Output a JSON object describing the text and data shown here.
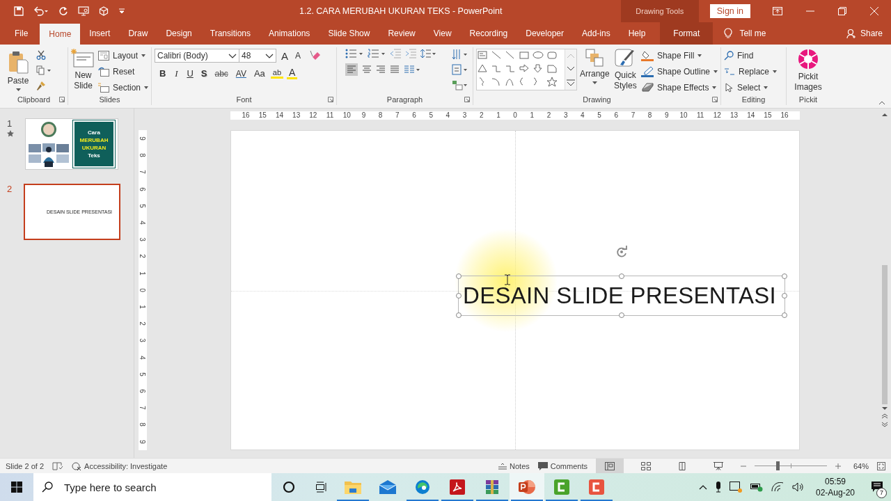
{
  "window": {
    "title": "1.2. CARA MERUBAH UKURAN TEKS  -  PowerPoint",
    "context_label": "Drawing Tools",
    "sign_in": "Sign in"
  },
  "tabs": [
    {
      "label": "File",
      "selected": false,
      "kind": "file"
    },
    {
      "label": "Home",
      "selected": true,
      "kind": "tab"
    },
    {
      "label": "Insert",
      "selected": false,
      "kind": "tab"
    },
    {
      "label": "Draw",
      "selected": false,
      "kind": "tab"
    },
    {
      "label": "Design",
      "selected": false,
      "kind": "tab"
    },
    {
      "label": "Transitions",
      "selected": false,
      "kind": "tab"
    },
    {
      "label": "Animations",
      "selected": false,
      "kind": "tab"
    },
    {
      "label": "Slide Show",
      "selected": false,
      "kind": "tab"
    },
    {
      "label": "Review",
      "selected": false,
      "kind": "tab"
    },
    {
      "label": "View",
      "selected": false,
      "kind": "tab"
    },
    {
      "label": "Recording",
      "selected": false,
      "kind": "tab"
    },
    {
      "label": "Developer",
      "selected": false,
      "kind": "tab"
    },
    {
      "label": "Add-ins",
      "selected": false,
      "kind": "tab"
    },
    {
      "label": "Help",
      "selected": false,
      "kind": "tab"
    },
    {
      "label": "Format",
      "selected": false,
      "kind": "contextual"
    }
  ],
  "tell_me": "Tell me",
  "share": "Share",
  "ribbon": {
    "clipboard": {
      "label": "Clipboard",
      "paste": "Paste"
    },
    "slides": {
      "label": "Slides",
      "new_slide": "New Slide",
      "commands": [
        {
          "label": "Layout",
          "kind": "layout"
        },
        {
          "label": "Reset",
          "kind": "reset"
        },
        {
          "label": "Section",
          "kind": "section"
        }
      ]
    },
    "font": {
      "label": "Font",
      "font_name": "Calibri (Body)",
      "font_size": "48",
      "size_buttons": [
        {
          "label": "A",
          "kind": "grow"
        },
        {
          "label": "A",
          "kind": "shrink"
        }
      ],
      "style_buttons": [
        {
          "label": "B",
          "kind": "bold"
        },
        {
          "label": "I",
          "kind": "italic"
        },
        {
          "label": "U",
          "kind": "underline"
        },
        {
          "label": "S",
          "kind": "shadow"
        },
        {
          "label": "abc",
          "kind": "strike"
        },
        {
          "label": "AV",
          "kind": "spacing"
        },
        {
          "label": "Aa",
          "kind": "case"
        }
      ],
      "highlight": "ab",
      "font_color": "A"
    },
    "paragraph": {
      "label": "Paragraph"
    },
    "drawing": {
      "label": "Drawing",
      "arrange": "Arrange",
      "quick_styles": "Quick Styles",
      "commands": [
        {
          "label": "Shape Fill",
          "kind": "fill"
        },
        {
          "label": "Shape Outline",
          "kind": "outline"
        },
        {
          "label": "Shape Effects",
          "kind": "effects"
        }
      ]
    },
    "editing": {
      "label": "Editing",
      "commands": [
        {
          "label": "Find",
          "kind": "find"
        },
        {
          "label": "Replace",
          "kind": "replace"
        },
        {
          "label": "Select",
          "kind": "select"
        }
      ]
    },
    "pickit": {
      "label": "Pickit",
      "button": "Pickit Images"
    }
  },
  "slides": [
    {
      "number": "1",
      "selected": false,
      "transition": true,
      "kind": "title",
      "lines": [
        {
          "text": "Cara",
          "highlight": false
        },
        {
          "text": "MERUBAH",
          "highlight": true
        },
        {
          "text": "UKURAN",
          "highlight": true
        },
        {
          "text": "Teks",
          "highlight": false
        }
      ]
    },
    {
      "number": "2",
      "selected": true,
      "transition": false,
      "kind": "text",
      "text": "DESAIN SLIDE PRESENTASI"
    }
  ],
  "rulers": {
    "horizontal": [
      "16",
      "15",
      "14",
      "13",
      "12",
      "11",
      "10",
      "9",
      "8",
      "7",
      "6",
      "5",
      "4",
      "3",
      "2",
      "1",
      "0",
      "1",
      "2",
      "3",
      "4",
      "5",
      "6",
      "7",
      "8",
      "9",
      "10",
      "11",
      "12",
      "13",
      "14",
      "15",
      "16"
    ],
    "vertical": [
      "9",
      "8",
      "7",
      "6",
      "5",
      "4",
      "3",
      "2",
      "1",
      "0",
      "1",
      "2",
      "3",
      "4",
      "5",
      "6",
      "7",
      "8",
      "9"
    ]
  },
  "slide": {
    "textbox": {
      "text": "DESAIN SLIDE PRESENTASI",
      "selected": true
    }
  },
  "status_bar": {
    "slide_info": "Slide 2 of 2",
    "accessibility": "Accessibility: Investigate",
    "notes": "Notes",
    "comments": "Comments",
    "views": [
      {
        "kind": "normal",
        "selected": true
      },
      {
        "kind": "sorter",
        "selected": false
      },
      {
        "kind": "reading",
        "selected": false
      },
      {
        "kind": "slideshow",
        "selected": false
      }
    ],
    "zoom": {
      "level": 0.32,
      "reading": "64%"
    }
  },
  "taskbar": {
    "search_placeholder": "Type here to search",
    "apps": [
      {
        "kind": "explorer",
        "running": true,
        "active": false
      },
      {
        "kind": "mail",
        "running": false,
        "active": false
      },
      {
        "kind": "edge",
        "running": true,
        "active": false
      },
      {
        "kind": "acrobat",
        "running": true,
        "active": false
      },
      {
        "kind": "archive",
        "running": true,
        "active": false
      },
      {
        "kind": "powerpoint",
        "running": true,
        "active": true
      },
      {
        "kind": "recorder",
        "running": true,
        "active": false
      },
      {
        "kind": "editor",
        "running": true,
        "active": false
      }
    ],
    "time": "05:59",
    "date": "02-Aug-20",
    "notifications": "7"
  }
}
